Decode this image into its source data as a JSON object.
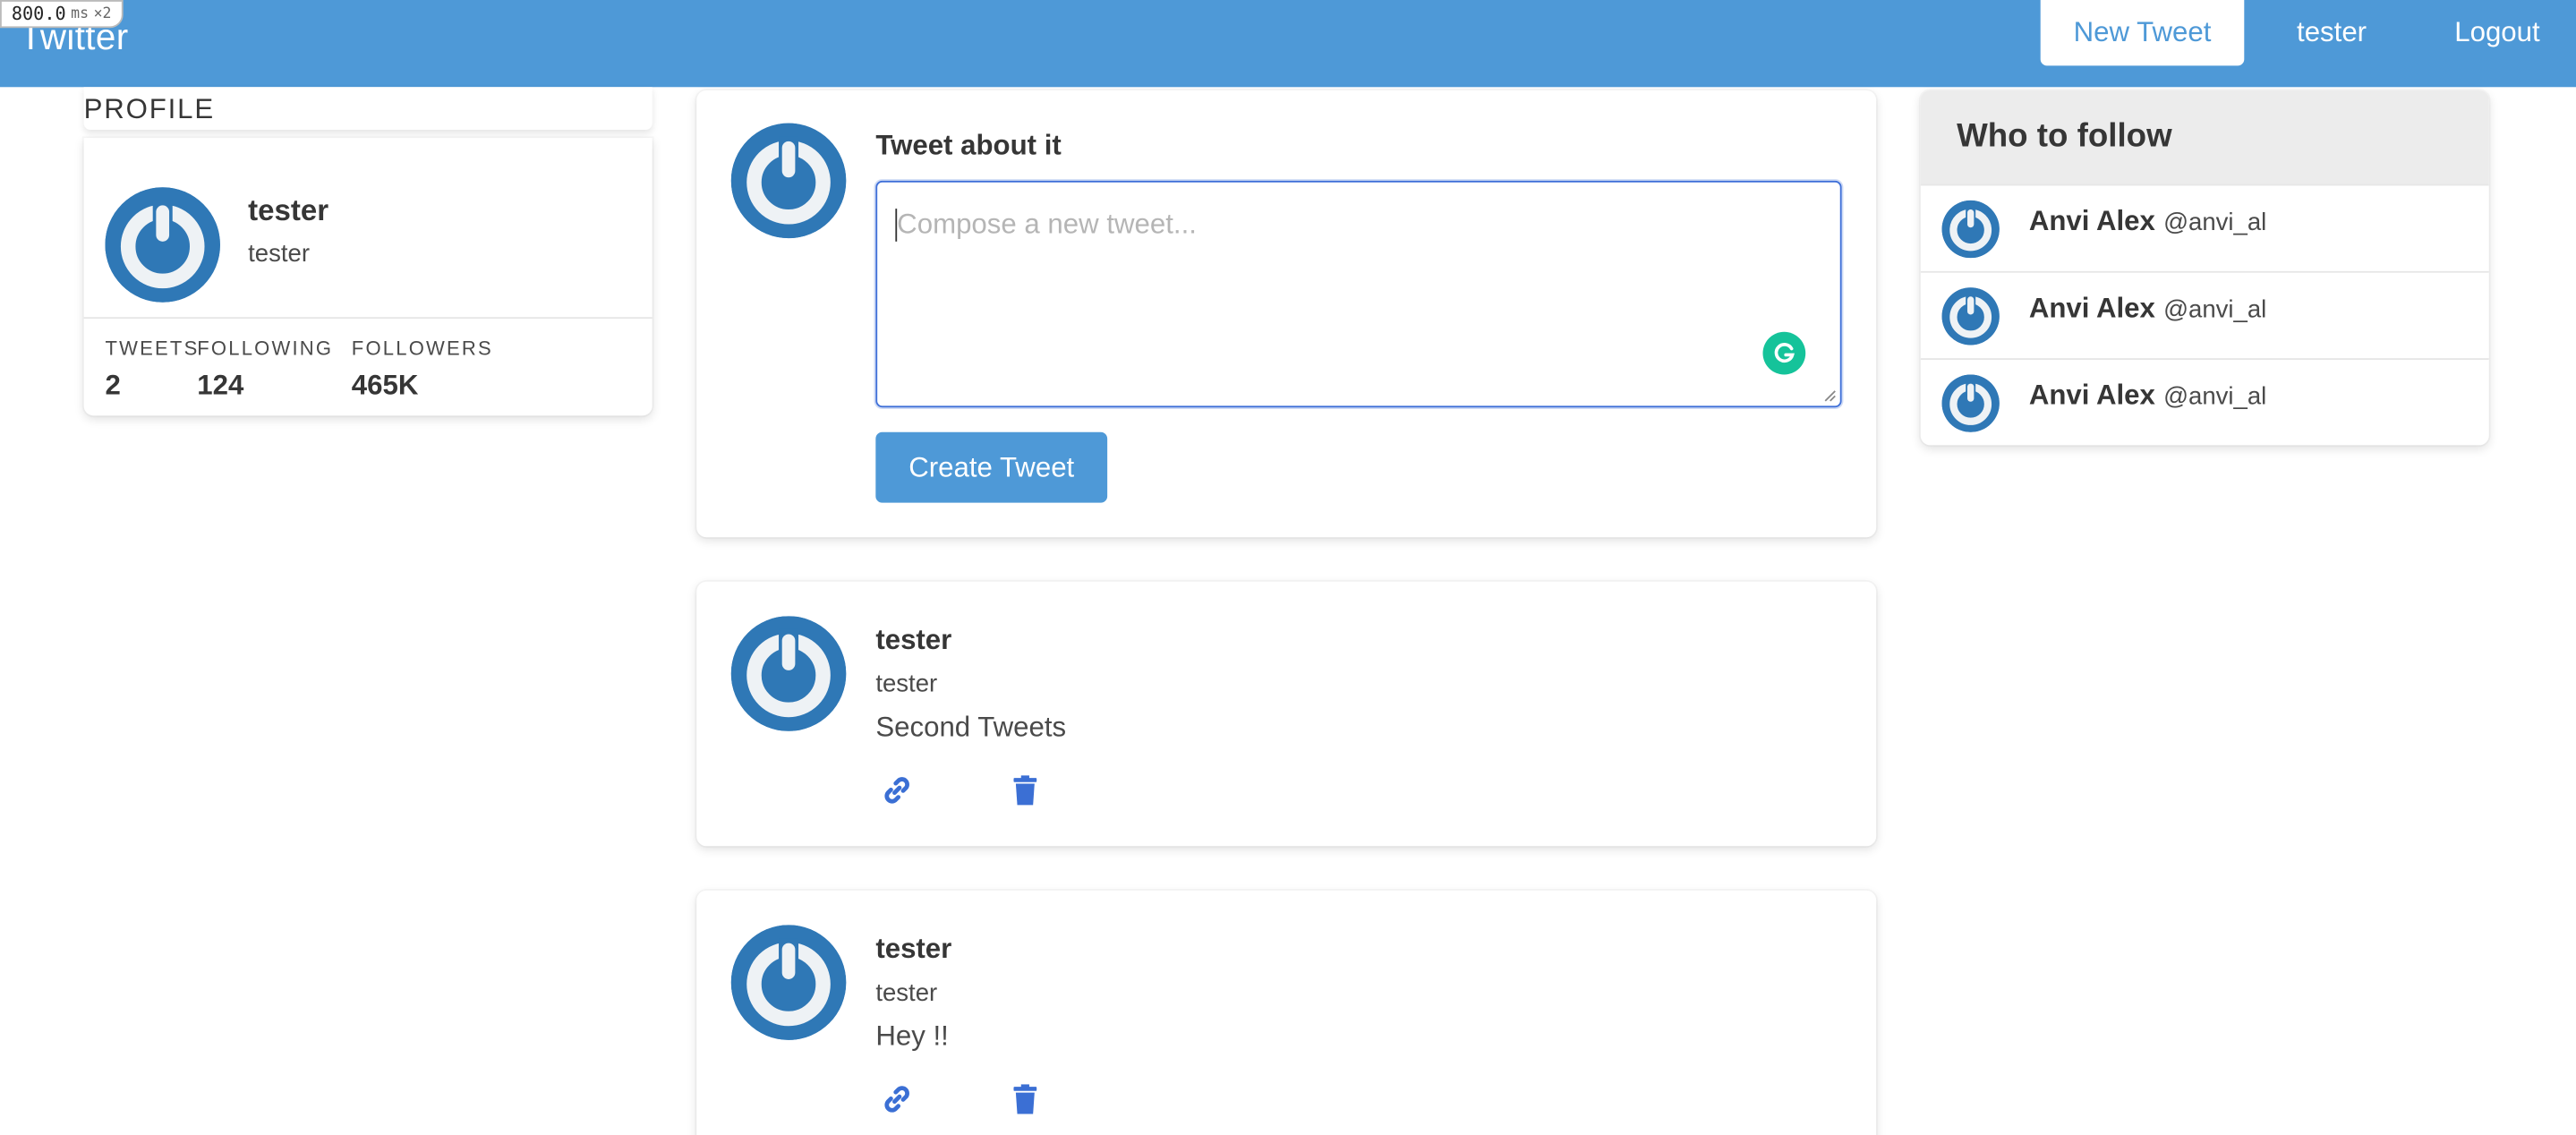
{
  "timer": {
    "value": "800.0",
    "unit": "ms",
    "multiplier": "×2"
  },
  "navbar": {
    "brand": "Twitter",
    "new_tweet": "New Tweet",
    "user": "tester",
    "logout": "Logout"
  },
  "profile": {
    "header": "PROFILE",
    "name": "tester",
    "handle": "tester",
    "stats": [
      {
        "label": "TWEETS",
        "value": "2"
      },
      {
        "label": "FOLLOWING",
        "value": "124"
      },
      {
        "label": "FOLLOWERS",
        "value": "465K"
      }
    ]
  },
  "compose": {
    "title": "Tweet about it",
    "placeholder": "Compose a new tweet...",
    "value": "",
    "button": "Create Tweet"
  },
  "tweets": [
    {
      "name": "tester",
      "handle": "tester",
      "text": "Second Tweets"
    },
    {
      "name": "tester",
      "handle": "tester",
      "text": "Hey !!"
    }
  ],
  "who_to_follow": {
    "title": "Who to follow",
    "items": [
      {
        "name": "Anvi Alex",
        "handle": "@anvi_al"
      },
      {
        "name": "Anvi Alex",
        "handle": "@anvi_al"
      },
      {
        "name": "Anvi Alex",
        "handle": "@anvi_al"
      }
    ]
  },
  "icons": {
    "avatar": "power-avatar-icon",
    "link": "link-icon",
    "delete": "trash-icon",
    "grammarly": "grammarly-icon"
  },
  "colors": {
    "navbar": "#4e99d7",
    "accent": "#4e99d7",
    "avatar": "#2f78b6",
    "icon_blue": "#3b6fd4",
    "grammarly": "#15c39a"
  }
}
